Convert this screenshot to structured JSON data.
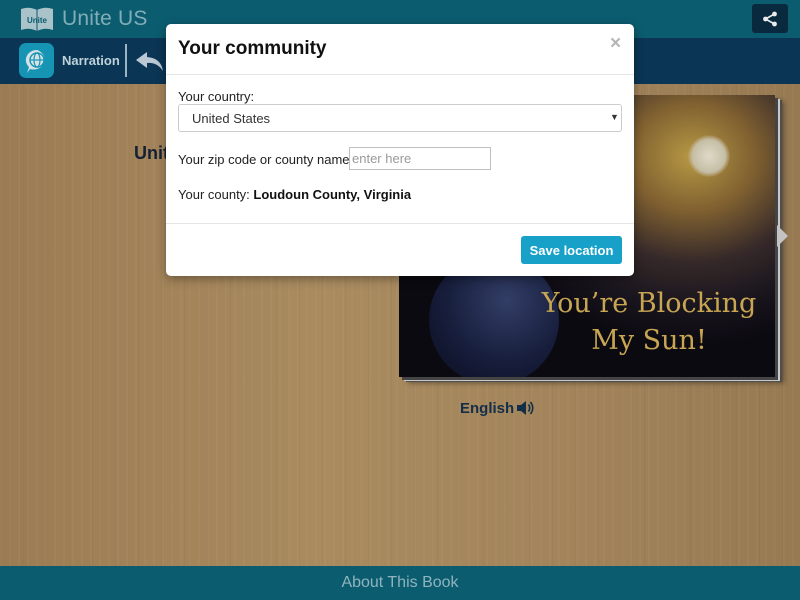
{
  "header": {
    "logo_text": "Unite",
    "title": "Unite US"
  },
  "toolbar": {
    "narration_label": "Narration"
  },
  "book": {
    "title_partial": "Unit",
    "cover_title_line1": "You’re Blocking",
    "cover_title_line2": "My Sun!",
    "language": "English"
  },
  "footer": {
    "label": "About This Book"
  },
  "modal": {
    "title": "Your community",
    "close_symbol": "×",
    "country_label": "Your country:",
    "country_value": "United States",
    "zip_label": "Your zip code or county name:",
    "zip_placeholder": "enter here",
    "zip_value": "",
    "county_prefix": "Your county:",
    "county_value": "Loudoun County, Virginia",
    "save_label": "Save location"
  }
}
